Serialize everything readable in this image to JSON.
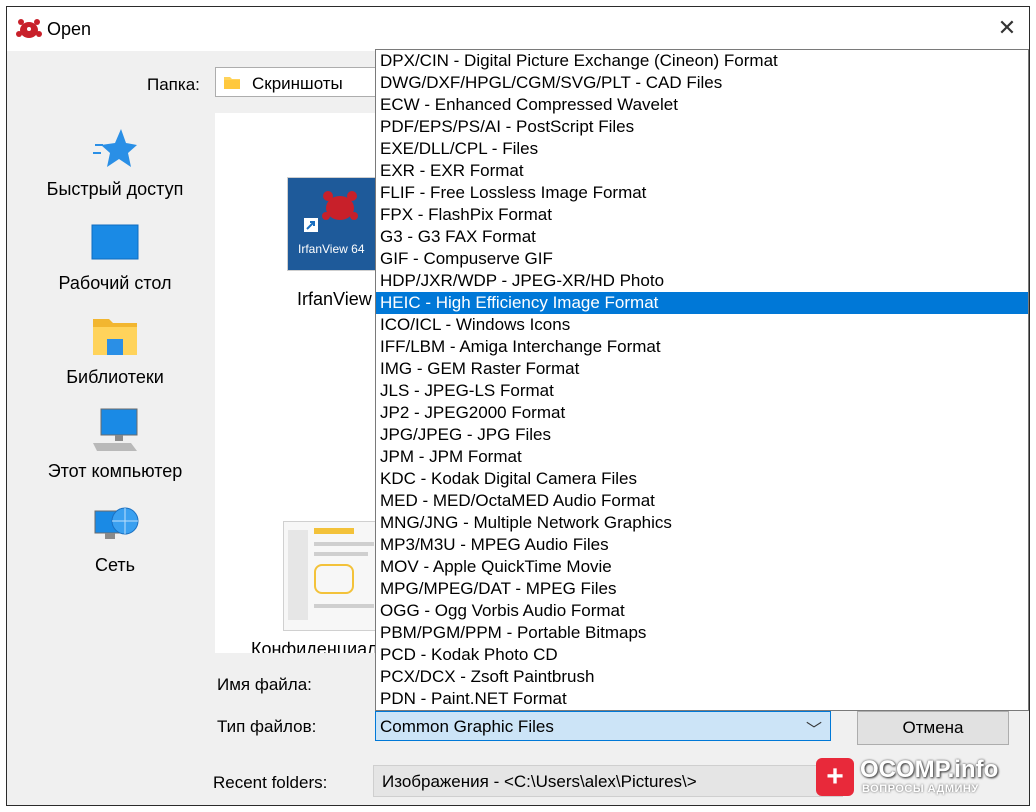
{
  "window": {
    "title": "Open"
  },
  "folder": {
    "label": "Папка:",
    "value": "Скриншоты"
  },
  "sidebar": {
    "items": [
      {
        "label": "Быстрый доступ",
        "icon": "star-icon"
      },
      {
        "label": "Рабочий стол",
        "icon": "desktop-icon"
      },
      {
        "label": "Библиотеки",
        "icon": "libraries-folder-icon"
      },
      {
        "label": "Этот компьютер",
        "icon": "computer-icon"
      },
      {
        "label": "Сеть",
        "icon": "network-icon"
      }
    ]
  },
  "files": [
    {
      "thumb_label": "IrfanView 64",
      "caption": "IrfanView"
    },
    {
      "caption": "Конфиденциальность"
    }
  ],
  "filename": {
    "label": "Имя файла:"
  },
  "filetype": {
    "label": "Тип файлов:",
    "value": "Common Graphic Files",
    "options": [
      "DPX/CIN - Digital Picture Exchange (Cineon) Format",
      "DWG/DXF/HPGL/CGM/SVG/PLT - CAD Files",
      "ECW - Enhanced Compressed Wavelet",
      "PDF/EPS/PS/AI - PostScript Files",
      "EXE/DLL/CPL - Files",
      "EXR - EXR Format",
      "FLIF - Free Lossless Image Format",
      "FPX - FlashPix Format",
      "G3 - G3 FAX Format",
      "GIF - Compuserve GIF",
      "HDP/JXR/WDP - JPEG-XR/HD Photo",
      "HEIC - High Efficiency Image Format",
      "ICO/ICL - Windows Icons",
      "IFF/LBM - Amiga Interchange Format",
      "IMG - GEM Raster Format",
      "JLS - JPEG-LS Format",
      "JP2 - JPEG2000 Format",
      "JPG/JPEG - JPG Files",
      "JPM - JPM Format",
      "KDC - Kodak Digital Camera Files",
      "MED - MED/OctaMED Audio Format",
      "MNG/JNG - Multiple Network Graphics",
      "MP3/M3U - MPEG Audio Files",
      "MOV - Apple QuickTime Movie",
      "MPG/MPEG/DAT - MPEG Files",
      "OGG - Ogg Vorbis Audio Format",
      "PBM/PGM/PPM - Portable Bitmaps",
      "PCD - Kodak Photo CD",
      "PCX/DCX - Zsoft Paintbrush",
      "PDN - Paint.NET Format"
    ],
    "selected_index": 11
  },
  "buttons": {
    "cancel": "Отмена"
  },
  "recent": {
    "label": "Recent folders:",
    "value": "Изображения  -  <C:\\Users\\alex\\Pictures\\>"
  },
  "watermark": {
    "brand": "OCOMP.info",
    "sub": "ВОПРОСЫ АДМИНУ"
  },
  "colors": {
    "selection": "#0078d7",
    "watermark_red": "#e8293a"
  }
}
